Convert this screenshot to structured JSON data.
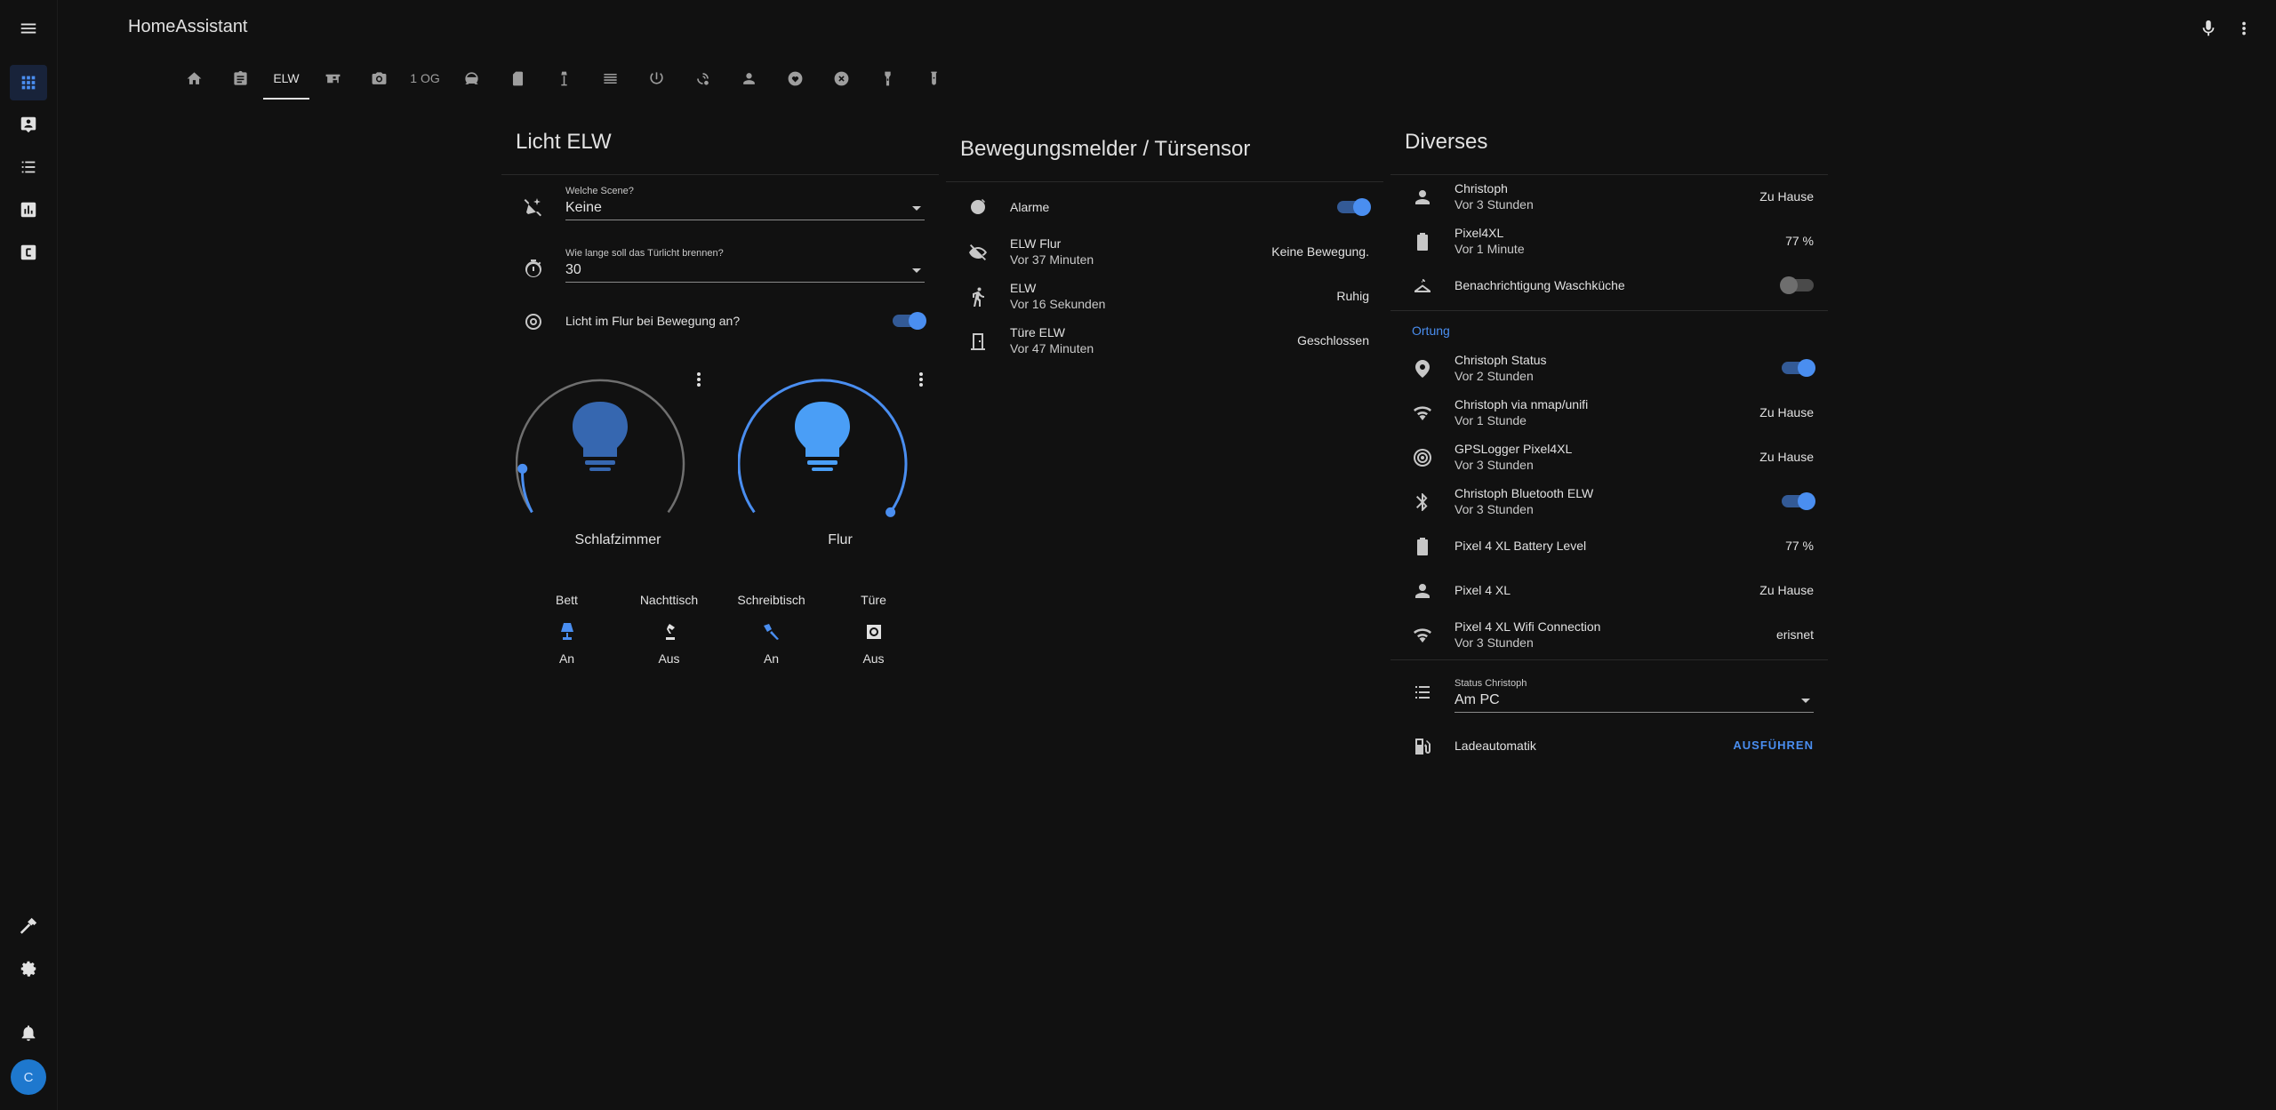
{
  "app": {
    "title": "HomeAssistant"
  },
  "sidebar": {
    "items": [
      {
        "icon": "view-dashboard-icon",
        "active": true
      },
      {
        "icon": "account-box-icon"
      },
      {
        "icon": "format-list-bulleted-icon"
      },
      {
        "icon": "chart-box-icon"
      },
      {
        "icon": "alpha-c-box-icon"
      }
    ],
    "bottom": [
      "hammer-icon",
      "cog-icon",
      "bell-icon"
    ],
    "avatar_initial": "C"
  },
  "toolbar": {
    "icons": [
      "microphone-icon",
      "dots-vertical-icon"
    ]
  },
  "tabs": [
    {
      "icon": "home-icon"
    },
    {
      "icon": "clipboard-icon"
    },
    {
      "label": "ELW",
      "active": true
    },
    {
      "icon": "desk-icon"
    },
    {
      "icon": "camera-icon"
    },
    {
      "label": "1 OG"
    },
    {
      "icon": "robot-vacuum-icon"
    },
    {
      "icon": "file-icon"
    },
    {
      "icon": "floor-lamp-icon"
    },
    {
      "icon": "radiator-icon"
    },
    {
      "icon": "power-icon"
    },
    {
      "icon": "weather-cloudy-icon"
    },
    {
      "icon": "account-icon"
    },
    {
      "icon": "shield-heart-icon"
    },
    {
      "icon": "close-circle-icon"
    },
    {
      "icon": "flashlight-icon"
    },
    {
      "icon": "test-tube-icon"
    }
  ],
  "card_licht": {
    "title": "Licht ELW",
    "scene": {
      "label": "Welche Scene?",
      "value": "Keine"
    },
    "duration": {
      "label": "Wie lange soll das Türlicht brennen?",
      "value": "30"
    },
    "motion_toggle": {
      "label": "Licht im Flur bei Bewegung an?",
      "on": true
    },
    "lights": [
      {
        "name": "Schlafzimmer",
        "brightness_pct": 5,
        "on": true
      },
      {
        "name": "Flur",
        "brightness_pct": 100,
        "on": true
      }
    ],
    "glance": [
      {
        "name": "Bett",
        "state": "An",
        "icon": "lamp-icon",
        "on": true
      },
      {
        "name": "Nachttisch",
        "state": "Aus",
        "icon": "desk-lamp-icon",
        "on": false
      },
      {
        "name": "Schreibtisch",
        "state": "An",
        "icon": "spotlight-icon",
        "on": true
      },
      {
        "name": "Türe",
        "state": "Aus",
        "icon": "wall-sconce-icon",
        "on": false
      }
    ]
  },
  "card_motion": {
    "title": "Bewegungsmelder / Türsensor",
    "rows": [
      {
        "name": "Alarme",
        "icon": "bell-alert-icon",
        "toggle": true
      },
      {
        "name": "ELW Flur",
        "secondary": "Vor 37 Minuten",
        "state": "Keine Bewegung.",
        "icon": "eye-off-icon"
      },
      {
        "name": "ELW",
        "secondary": "Vor 16 Sekunden",
        "state": "Ruhig",
        "icon": "walk-icon"
      },
      {
        "name": "Türe ELW",
        "secondary": "Vor 47 Minuten",
        "state": "Geschlossen",
        "icon": "door-closed-icon"
      }
    ]
  },
  "card_diverses": {
    "title": "Diverses",
    "rows_top": [
      {
        "name": "Christoph",
        "secondary": "Vor 3 Stunden",
        "state": "Zu Hause",
        "icon": "account-icon"
      },
      {
        "name": "Pixel4XL",
        "secondary": "Vor 1 Minute",
        "state": "77 %",
        "icon": "battery-icon"
      },
      {
        "name": "Benachrichtigung Waschküche",
        "icon": "hanger-icon",
        "toggle": false
      }
    ],
    "section": "Ortung",
    "rows_ortung": [
      {
        "name": "Christoph Status",
        "secondary": "Vor 2 Stunden",
        "icon": "map-marker-radius-icon",
        "toggle": true
      },
      {
        "name": "Christoph via nmap/unifi",
        "secondary": "Vor 1 Stunde",
        "state": "Zu Hause",
        "icon": "wifi-icon"
      },
      {
        "name": "GPSLogger Pixel4XL",
        "secondary": "Vor 3 Stunden",
        "state": "Zu Hause",
        "icon": "crosshairs-gps-icon"
      },
      {
        "name": "Christoph Bluetooth ELW",
        "secondary": "Vor 3 Stunden",
        "icon": "bluetooth-icon",
        "toggle": true
      },
      {
        "name": "Pixel 4 XL Battery Level",
        "state": "77 %",
        "icon": "battery-icon"
      },
      {
        "name": "Pixel 4 XL",
        "state": "Zu Hause",
        "icon": "account-icon"
      },
      {
        "name": "Pixel 4 XL Wifi Connection",
        "secondary": "Vor 3 Stunden",
        "state": "erisnet",
        "icon": "wifi-icon"
      }
    ],
    "status": {
      "label": "Status Christoph",
      "value": "Am PC",
      "icon": "format-list-bulleted-icon"
    },
    "script": {
      "name": "Ladeautomatik",
      "action": "AUSFÜHREN",
      "icon": "ev-station-icon"
    }
  }
}
